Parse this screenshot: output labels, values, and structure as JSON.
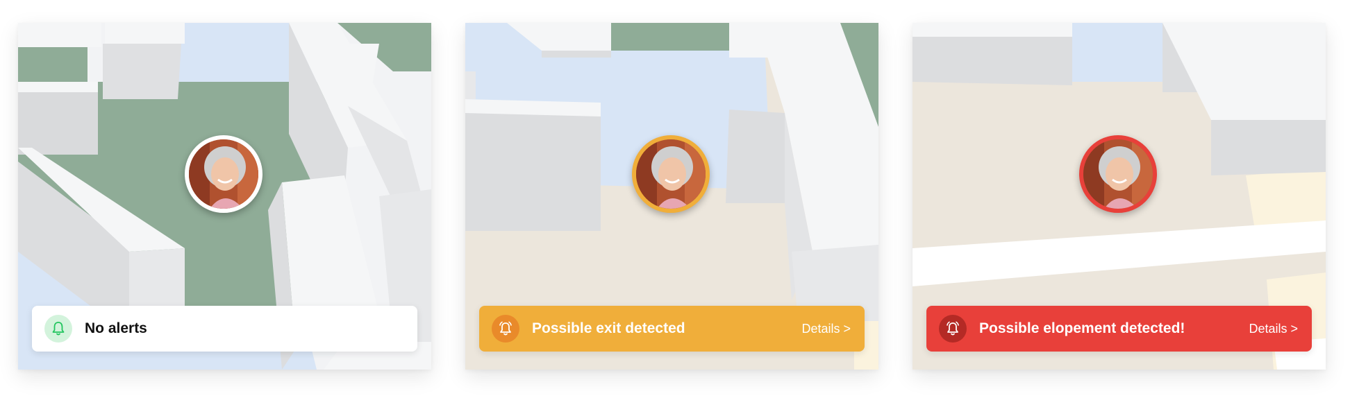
{
  "colors": {
    "ok_accent": "#22c55e",
    "warning": "#f0ae3a",
    "danger": "#e8403a",
    "floor_green": "#8fac97",
    "floor_blue": "#d8e5f6",
    "floor_beige": "#ece6dc",
    "wall_top": "#f2f3f5"
  },
  "cards": [
    {
      "status": "ok",
      "avatar_ring": "white",
      "alert_icon": "bell-icon",
      "alert_text": "No alerts",
      "details_label": ""
    },
    {
      "status": "warning",
      "avatar_ring": "orange",
      "alert_icon": "bell-ringing-icon",
      "alert_text": "Possible exit detected",
      "details_label": "Details >"
    },
    {
      "status": "danger",
      "avatar_ring": "red",
      "alert_icon": "bell-ringing-icon",
      "alert_text": "Possible elopement detected!",
      "details_label": "Details >"
    }
  ]
}
